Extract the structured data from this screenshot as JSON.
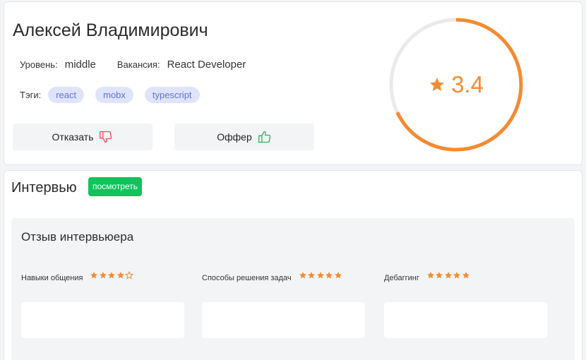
{
  "candidate": {
    "name": "Алексей Владимирович",
    "level_label": "Уровень:",
    "level_value": "middle",
    "vacancy_label": "Вакансия:",
    "vacancy_value": "React Developer",
    "tags_label": "Тэги:",
    "tags": [
      "react",
      "mobx",
      "typescript"
    ]
  },
  "actions": {
    "reject_label": "Отказать",
    "offer_label": "Оффер"
  },
  "rating": {
    "value": "3.4",
    "max": 5,
    "color": "#f48b32",
    "track_color": "#eaeaea"
  },
  "interview": {
    "title": "Интервью",
    "view_label": "посмотреть",
    "badge_color": "#10c35a"
  },
  "feedback": {
    "title": "Отзыв интервьюера",
    "criteria": [
      {
        "label": "Навыки общения",
        "stars": 4,
        "max": 5
      },
      {
        "label": "Способы решения задач",
        "stars": 5,
        "max": 5
      },
      {
        "label": "Дебаггинг",
        "stars": 5,
        "max": 5
      }
    ]
  },
  "icons": {
    "reject": "thumbs-down-icon",
    "offer": "thumbs-up-icon",
    "rating": "star-icon"
  }
}
